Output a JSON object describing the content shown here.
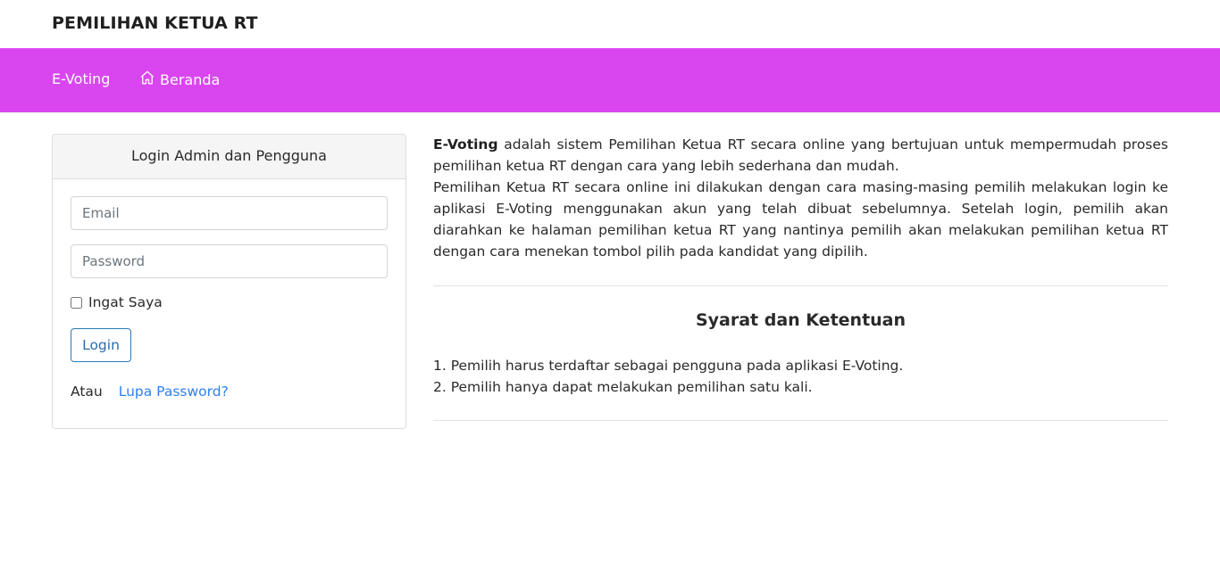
{
  "header": {
    "title": "PEMILIHAN KETUA RT"
  },
  "nav": {
    "evoting_label": "E-Voting",
    "home_label": "Beranda",
    "home_icon": "home-icon",
    "background_color": "#d946ef"
  },
  "login_card": {
    "title": "Login Admin dan Pengguna",
    "email_placeholder": "Email",
    "email_value": "",
    "password_placeholder": "Password",
    "password_value": "",
    "remember_label": "Ingat Saya",
    "remember_checked": false,
    "login_button": "Login",
    "or_text": "Atau",
    "forgot_link": "Lupa Password?"
  },
  "intro": {
    "brand": "E-Voting",
    "paragraph1_rest": " adalah sistem Pemilihan Ketua RT secara online yang bertujuan untuk mempermudah proses pemilihan ketua RT dengan cara yang lebih sederhana dan mudah.",
    "paragraph2": "Pemilihan Ketua RT secara online ini dilakukan dengan cara masing-masing pemilih melakukan login ke aplikasi E-Voting menggunakan akun yang telah dibuat sebelumnya. Setelah login, pemilih akan diarahkan ke halaman pemilihan ketua RT yang nantinya pemilih akan melakukan pemilihan ketua RT dengan cara menekan tombol pilih pada kandidat yang dipilih."
  },
  "terms": {
    "title": "Syarat dan Ketentuan",
    "items": [
      "1. Pemilih harus terdaftar sebagai pengguna pada aplikasi E-Voting.",
      "2. Pemilih hanya dapat melakukan pemilihan satu kali."
    ]
  }
}
